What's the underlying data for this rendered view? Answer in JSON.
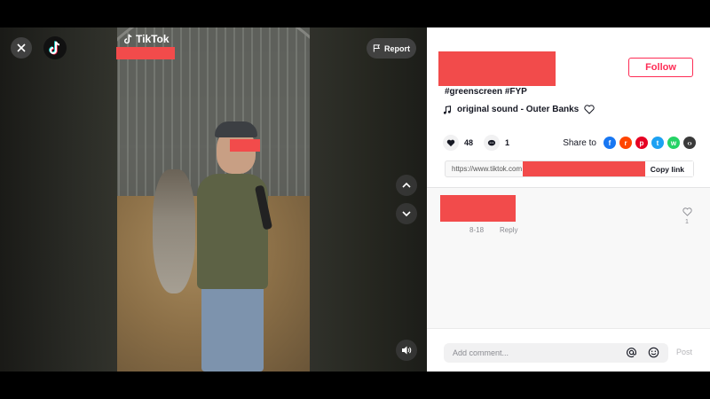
{
  "video": {
    "watermark": "TikTok",
    "report_label": "Report"
  },
  "post": {
    "follow_label": "Follow",
    "caption": "#greenscreen #FYP",
    "sound": "original sound - Outer Banks",
    "likes": "48",
    "comments": "1",
    "share_label": "Share to",
    "share_icons": [
      "facebook-icon",
      "reddit-icon",
      "pinterest-icon",
      "twitter-icon",
      "whatsapp-icon",
      "embed-icon"
    ],
    "link_url": "https://www.tiktok.com",
    "copy_link_label": "Copy link"
  },
  "comment": {
    "date": "8-18",
    "reply_label": "Reply",
    "like_count": "1"
  },
  "composer": {
    "placeholder": "Add comment...",
    "post_label": "Post"
  },
  "colors": {
    "accent": "#fe2c55",
    "redaction": "#f24b4b"
  }
}
